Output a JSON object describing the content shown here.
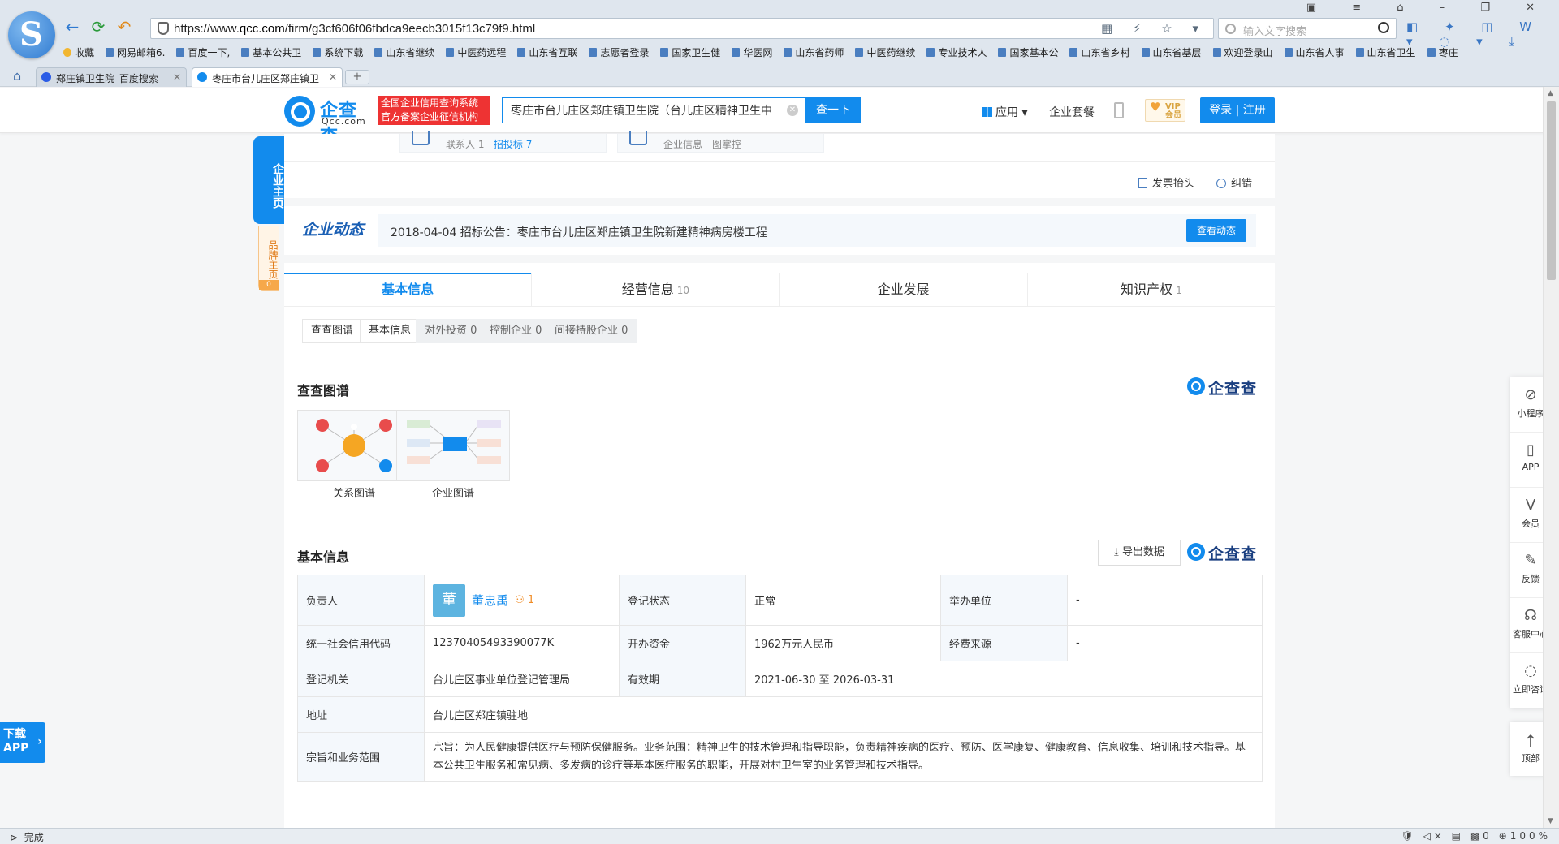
{
  "browser": {
    "url_prefix": "https://www.",
    "url_host": "qcc.com",
    "url_path": "/firm/g3cf606f06fbdca9eecb3015f13c79f9.html",
    "search_placeholder": "输入文字搜索",
    "bookmarks": [
      "收藏",
      "网易邮箱6.",
      "百度一下,",
      "基本公共卫",
      "系统下载",
      "山东省继续",
      "中医药远程",
      "山东省互联",
      "志愿者登录",
      "国家卫生健",
      "华医网",
      "山东省药师",
      "中医药继续",
      "专业技术人",
      "国家基本公",
      "山东省乡村",
      "山东省基层",
      "欢迎登录山",
      "山东省人事",
      "山东省卫生",
      "枣庄"
    ],
    "tabs": [
      {
        "label": "郑庄镇卫生院_百度搜索",
        "active": false
      },
      {
        "label": "枣庄市台儿庄区郑庄镇卫",
        "active": true
      }
    ],
    "status_left": "完成",
    "status_zoom": "100%",
    "status_count": "0"
  },
  "header": {
    "logo_name": "企查查",
    "logo_domain": "Qcc.com",
    "badge_line1": "全国企业信用查询系统",
    "badge_line2": "官方备案企业征信机构",
    "search_value": "枣庄市台儿庄区郑庄镇卫生院（台儿庄区精神卫生中心）",
    "search_button": "查一下",
    "apps": "应用",
    "package": "企业套餐",
    "vip_top": "VIP",
    "vip_bottom": "会员",
    "login": "登录 | 注册"
  },
  "top_cards": {
    "card1_contacts": "联系人 1",
    "card1_bids": "招投标 7",
    "card2_text": "企业信息一图掌控"
  },
  "utils": {
    "invoice": "发票抬头",
    "correct": "纠错"
  },
  "news": {
    "title": "企业动态",
    "text": "2018-04-04 招标公告：枣庄市台儿庄区郑庄镇卫生院新建精神病房楼工程",
    "button": "查看动态"
  },
  "main_tabs": [
    {
      "label": "基本信息",
      "count": ""
    },
    {
      "label": "经营信息",
      "count": "10"
    },
    {
      "label": "企业发展",
      "count": ""
    },
    {
      "label": "知识产权",
      "count": "1"
    }
  ],
  "sub_tabs": [
    "查查图谱",
    "基本信息",
    "对外投资 0",
    "控制企业 0",
    "间接持股企业 0"
  ],
  "graph_section": {
    "title": "查查图谱",
    "thumbs": [
      "关系图谱",
      "企业图谱"
    ]
  },
  "basic_section": {
    "title": "基本信息",
    "export": "导出数据"
  },
  "basic_info": {
    "legal_label": "负责人",
    "avatar_char": "董",
    "legal_name": "董忠禹",
    "legal_relations": "1",
    "status_label": "登记状态",
    "status_value": "正常",
    "sponsor_label": "举办单位",
    "sponsor_value": "-",
    "credit_label": "统一社会信用代码",
    "credit_value": "12370405493390077K",
    "capital_label": "开办资金",
    "capital_value": "1962万元人民币",
    "funding_label": "经费来源",
    "funding_value": "-",
    "authority_label": "登记机关",
    "authority_value": "台儿庄区事业单位登记管理局",
    "validity_label": "有效期",
    "validity_value": "2021-06-30 至 2026-03-31",
    "address_label": "地址",
    "address_value": "台儿庄区郑庄镇驻地",
    "scope_label": "宗旨和业务范围",
    "scope_value": "宗旨：为人民健康提供医疗与预防保健服务。业务范围：精神卫生的技术管理和指导职能，负责精神疾病的医疗、预防、医学康复、健康教育、信息收集、培训和技术指导。基本公共卫生服务和常见病、多发病的诊疗等基本医疗服务的职能，开展对村卫生室的业务管理和技术指导。"
  },
  "left_float": {
    "main": "企业主页",
    "brand": "品牌主页",
    "brand_count": "0"
  },
  "right_float": [
    "小程序",
    "APP",
    "会员",
    "反馈",
    "客服中心",
    "立即咨询",
    "顶部"
  ],
  "download_app": {
    "line1": "下载",
    "line2": "APP"
  }
}
